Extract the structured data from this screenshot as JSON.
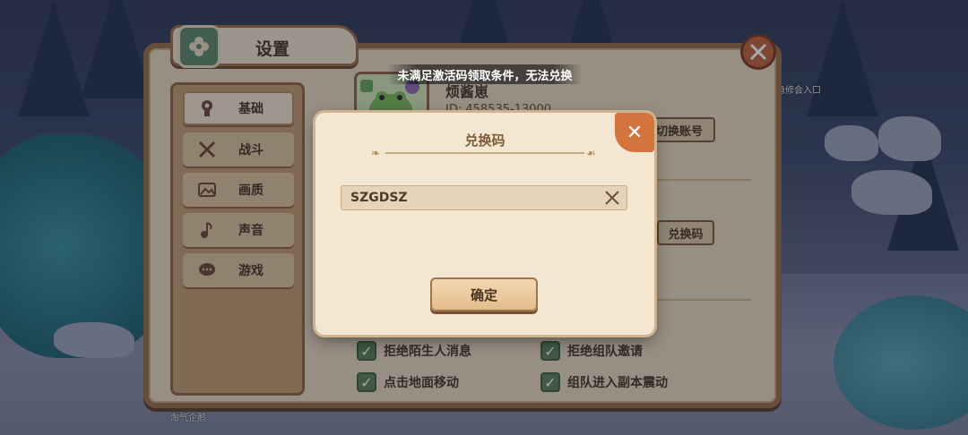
{
  "toast": "未满足激活码领取条件，无法兑换",
  "settings": {
    "title": "设置",
    "tabs": [
      {
        "label": "基础",
        "icon": "keyhole-icon",
        "active": true
      },
      {
        "label": "战斗",
        "icon": "crossed-swords-icon",
        "active": false
      },
      {
        "label": "画质",
        "icon": "image-icon",
        "active": false
      },
      {
        "label": "声音",
        "icon": "music-note-icon",
        "active": false
      },
      {
        "label": "游戏",
        "icon": "chat-bubble-icon",
        "active": false
      }
    ],
    "player": {
      "name": "烦酱崽",
      "id": "ID: 458535-13000"
    },
    "switch_account_label": "切换账号",
    "redeem_label": "兑换码",
    "options": [
      {
        "label": "拒绝陌生人消息",
        "checked": true
      },
      {
        "label": "拒绝组队邀请",
        "checked": true
      },
      {
        "label": "点击地面移动",
        "checked": true
      },
      {
        "label": "组队进入副本震动",
        "checked": true
      }
    ]
  },
  "dialog": {
    "title": "兑换码",
    "code_value": "SZGDSZ",
    "confirm_label": "确定"
  },
  "background": {
    "location_label": "隐修会入口",
    "corner_text": "淘气企鹅"
  },
  "colors": {
    "panel_bg": "#e9d9bd",
    "dialog_bg": "#f3e7d1",
    "accent_orange": "#d3743f",
    "checkbox_green": "#5c8258"
  }
}
